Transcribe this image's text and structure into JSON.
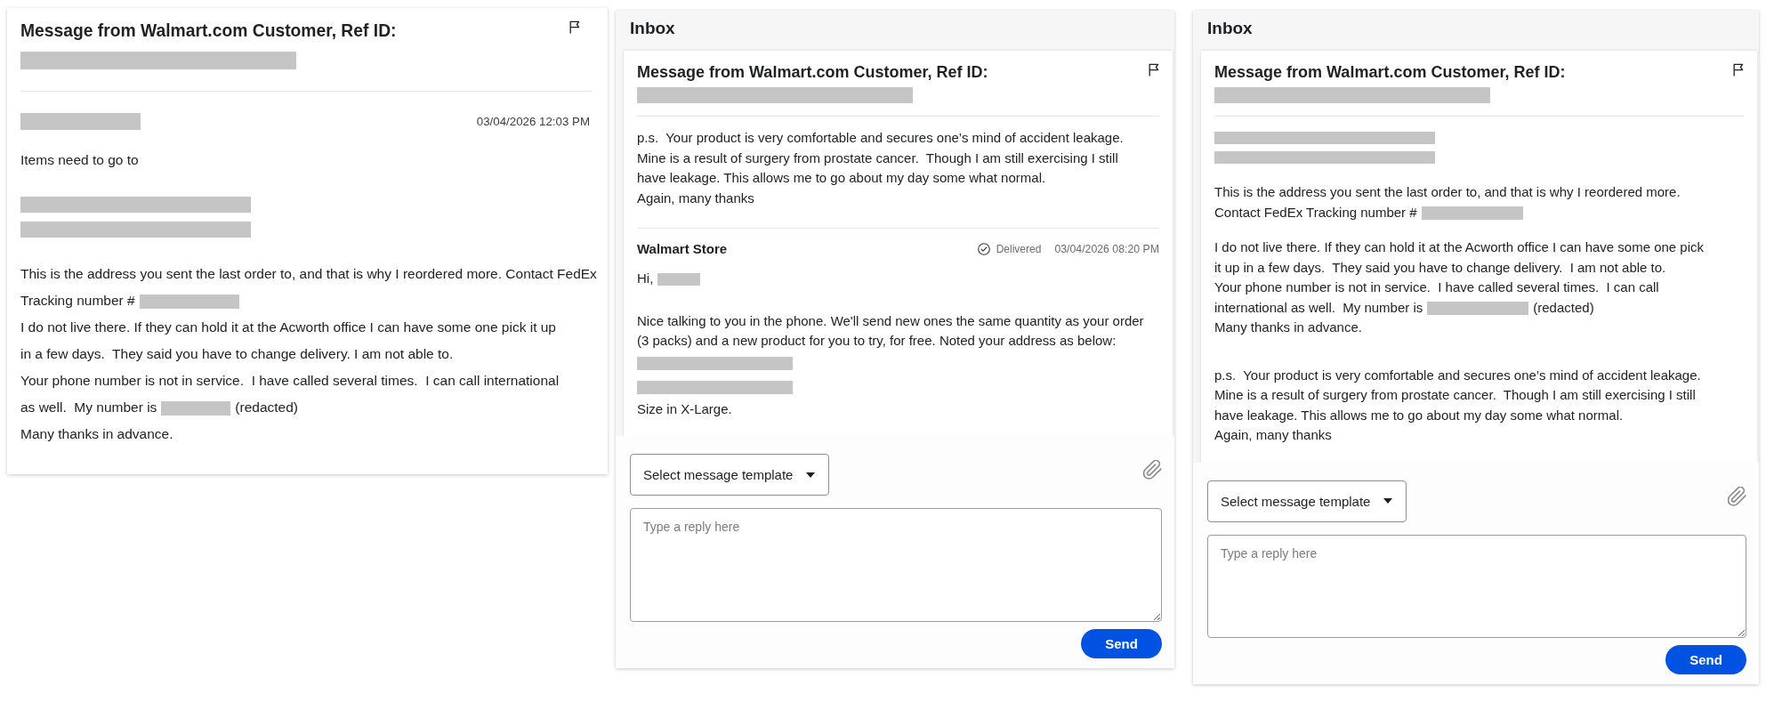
{
  "panels": [
    {
      "kind": "detail",
      "title": "Message from Walmart.com Customer, Ref ID:",
      "ref_id_redacted": true,
      "messages": [
        {
          "kind": "received",
          "sender_redacted": true,
          "time": "03/04/2026 12:03 PM",
          "paragraphs": [
            {
              "lines": [
                [
                  {
                    "kind": "text",
                    "text": "Items need to go to"
                  }
                ]
              ]
            },
            {
              "lines": [
                [
                  {
                    "kind": "redacted"
                  }
                ],
                [
                  {
                    "kind": "redacted"
                  }
                ]
              ]
            },
            {
              "lines": [
                [
                  {
                    "kind": "text",
                    "text": "This is the address you sent the last order to, and that is why I reordered more. Contact FedEx"
                  }
                ],
                [
                  {
                    "kind": "text",
                    "text": "Tracking number #"
                  },
                  {
                    "kind": "redacted"
                  }
                ],
                [
                  {
                    "kind": "text",
                    "text": "I do not live there. If they can hold it at the Acworth office I can have some one pick it up"
                  }
                ],
                [
                  {
                    "kind": "text",
                    "text": "in a few days.  They said you have to change delivery. I am not able to."
                  }
                ],
                [
                  {
                    "kind": "text",
                    "text": "Your phone number is not in service.  I have called several times.  I can call international"
                  }
                ],
                [
                  {
                    "kind": "text",
                    "text": "as well.  My number is"
                  },
                  {
                    "kind": "redacted"
                  },
                  {
                    "kind": "text",
                    "text": "(redacted)"
                  }
                ],
                [
                  {
                    "kind": "text",
                    "text": "Many thanks in advance."
                  }
                ]
              ]
            }
          ]
        }
      ]
    },
    {
      "kind": "inbox",
      "header": "Inbox",
      "title": "Message from Walmart.com Customer, Ref ID:",
      "ref_id_redacted": true,
      "messages": [
        {
          "kind": "received",
          "postscript": {
            "lines": [
              [
                {
                  "kind": "text",
                  "text": "p.s.  Your product is very comfortable and secures one’s mind of accident leakage."
                }
              ],
              [
                {
                  "kind": "text",
                  "text": "Mine is a result of surgery from prostate cancer.  Though I am still exercising I still"
                }
              ],
              [
                {
                  "kind": "text",
                  "text": "have leakage. This allows me to go about my day some what normal."
                }
              ],
              [
                {
                  "kind": "text",
                  "text": "Again, many thanks"
                }
              ]
            ]
          }
        },
        {
          "kind": "sent",
          "sender": "Walmart Store",
          "status": "Delivered",
          "time": "03/04/2026 08:20 PM",
          "paragraphs": [
            {
              "lines": [
                [
                  {
                    "kind": "text",
                    "text": "Hi,"
                  },
                  {
                    "kind": "redacted"
                  }
                ]
              ]
            },
            {
              "lines": [
                [
                  {
                    "kind": "text",
                    "text": "Nice talking to you in the phone. We'll send new ones the same quantity as your order (3 packs) and a new product for you to try, for free. Noted your address as below:"
                  }
                ],
                [
                  {
                    "kind": "redacted"
                  }
                ],
                [
                  {
                    "kind": "redacted"
                  }
                ],
                [
                  {
                    "kind": "text",
                    "text": "Size in X-Large."
                  }
                ]
              ]
            }
          ]
        }
      ],
      "composer": {
        "template_select": "Select message template",
        "reply_placeholder": "Type a reply here",
        "send_button": "Send"
      }
    },
    {
      "kind": "inbox",
      "header": "Inbox",
      "title": "Message from Walmart.com Customer, Ref ID:",
      "ref_id_redacted": true,
      "messages": [
        {
          "kind": "received",
          "paragraphs": [
            {
              "lines": [
                [
                  {
                    "kind": "redacted"
                  }
                ],
                [
                  {
                    "kind": "redacted"
                  }
                ]
              ]
            },
            {
              "lines": [
                [
                  {
                    "kind": "text",
                    "text": "This is the address you sent the last order to, and that is why I reordered more."
                  }
                ],
                [
                  {
                    "kind": "text",
                    "text": "Contact FedEx Tracking number #"
                  },
                  {
                    "kind": "redacted"
                  }
                ]
              ]
            },
            {
              "lines": [
                [
                  {
                    "kind": "text",
                    "text": "I do not live there. If they can hold it at the Acworth office I can have some one pick it up in a few days.  They said you have to change delivery.  I am not able to."
                  }
                ],
                [
                  {
                    "kind": "text",
                    "text": "Your phone number is not in service.  I have called several times.  I can call"
                  }
                ],
                [
                  {
                    "kind": "text",
                    "text": "international as well.  My number is"
                  },
                  {
                    "kind": "redacted"
                  },
                  {
                    "kind": "text",
                    "text": "(redacted)"
                  }
                ],
                [
                  {
                    "kind": "text",
                    "text": "Many thanks in advance."
                  }
                ]
              ]
            }
          ],
          "postscript": {
            "lines": [
              [
                {
                  "kind": "text",
                  "text": "p.s.  Your product is very comfortable and secures one’s mind of accident leakage."
                }
              ],
              [
                {
                  "kind": "text",
                  "text": "Mine is a result of surgery from prostate cancer.  Though I am still exercising I still"
                }
              ],
              [
                {
                  "kind": "text",
                  "text": "have leakage. This allows me to go about my day some what normal."
                }
              ],
              [
                {
                  "kind": "text",
                  "text": "Again, many thanks"
                }
              ]
            ]
          }
        }
      ],
      "composer": {
        "template_select": "Select message template",
        "reply_placeholder": "Type a reply here",
        "send_button": "Send"
      }
    }
  ]
}
